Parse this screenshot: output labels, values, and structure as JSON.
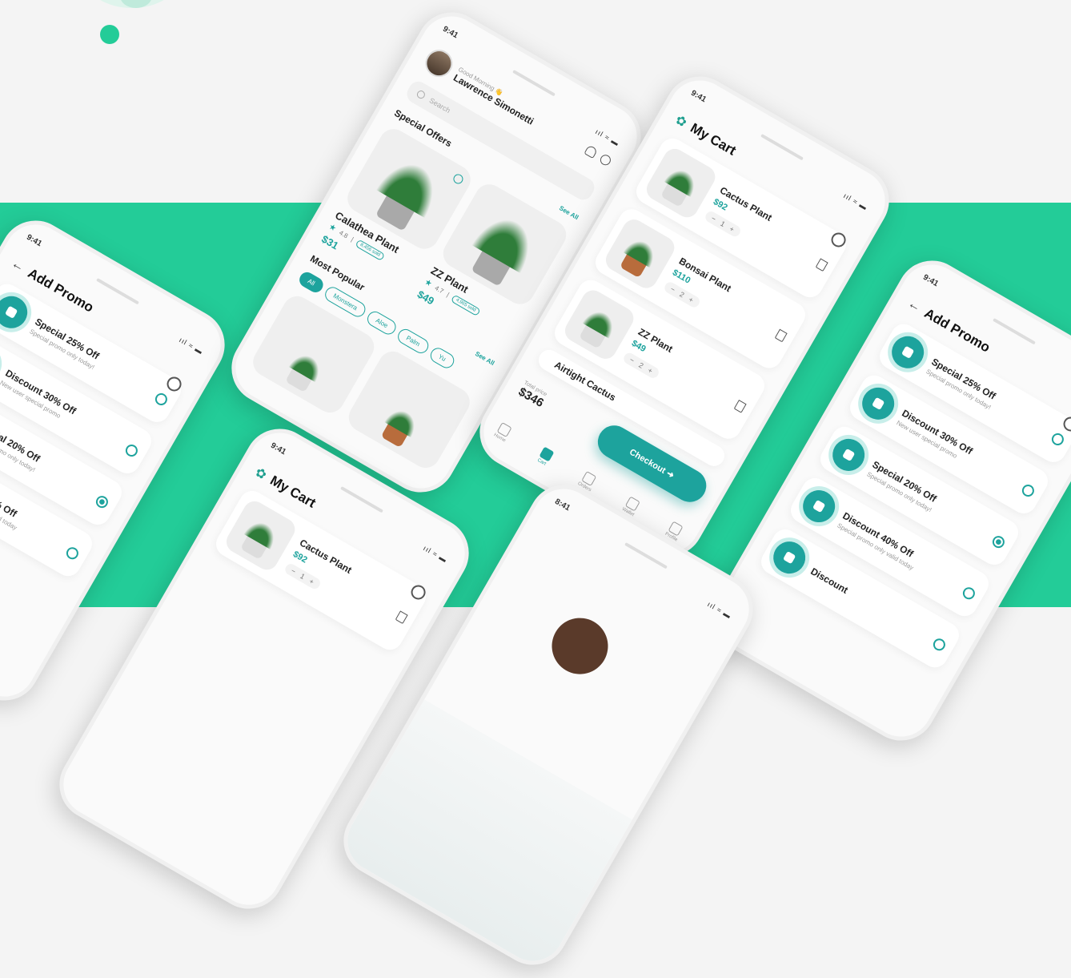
{
  "colors": {
    "accent": "#1da39d",
    "brand_green": "#23cc98",
    "background": "#f4f4f4"
  },
  "status": {
    "time": "9:41",
    "time_alt": "8:41",
    "icons": "ııl ≈ ▬"
  },
  "home": {
    "greeting": "Good Morning 👋",
    "user_name": "Lawrence Simonetti",
    "search_placeholder": "Search",
    "special_offers": "Special Offers",
    "see_all": "See All",
    "offers": [
      {
        "name": "Calathea Plant",
        "rating": "4.8",
        "badge": "8,456 sold",
        "price": "$31"
      },
      {
        "name": "ZZ Plant",
        "rating": "4.7",
        "badge": "4,965 sold",
        "price": "$49"
      }
    ],
    "most_popular": "Most Popular",
    "chips": [
      "All",
      "Monstera",
      "Aloe",
      "Palm",
      "Yu"
    ]
  },
  "cart": {
    "title": "My Cart",
    "items": [
      {
        "name": "Cactus Plant",
        "price": "$92",
        "qty": "1"
      },
      {
        "name": "Bonsai Plant",
        "price": "$110",
        "qty": "2"
      },
      {
        "name": "ZZ Plant",
        "price": "$49",
        "qty": "2"
      },
      {
        "name": "Airtight Cactus",
        "price": "",
        "qty": ""
      }
    ],
    "total_label": "Total price",
    "total": "$346",
    "checkout": "Checkout ➜",
    "tabs": [
      "Home",
      "Cart",
      "Orders",
      "Wallet",
      "Profile"
    ]
  },
  "promo": {
    "title": "Add Promo",
    "items": [
      {
        "title": "Special 25% Off",
        "subtitle": "Special promo only today!",
        "selected": false
      },
      {
        "title": "Discount 30% Off",
        "subtitle": "New user special promo",
        "selected": false
      },
      {
        "title": "Special 20% Off",
        "subtitle": "Special promo only today!",
        "selected": true
      },
      {
        "title": "Discount 40% Off",
        "subtitle": "Special promo only valid today",
        "selected": false
      },
      {
        "title": "Discount",
        "subtitle": "",
        "selected": false
      }
    ]
  }
}
